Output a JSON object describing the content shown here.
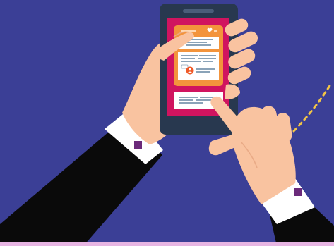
{
  "colors": {
    "background": "#3b3f96",
    "phone_body": "#28384f",
    "screen": "#d0145f",
    "card_orange": "#f3943c",
    "skin": "#f9c3a0",
    "skin_shadow": "#e9aa86",
    "sleeve": "#0a0a0a",
    "cuff": "#ffffff",
    "cufflink": "#6b2a7a",
    "accent_dash": "#f3c545",
    "bottom_strip": "#e7b5e3"
  },
  "icons": {
    "like": "heart-icon",
    "avatar": "user-avatar-icon",
    "comment": "comment-bubble-icon"
  }
}
